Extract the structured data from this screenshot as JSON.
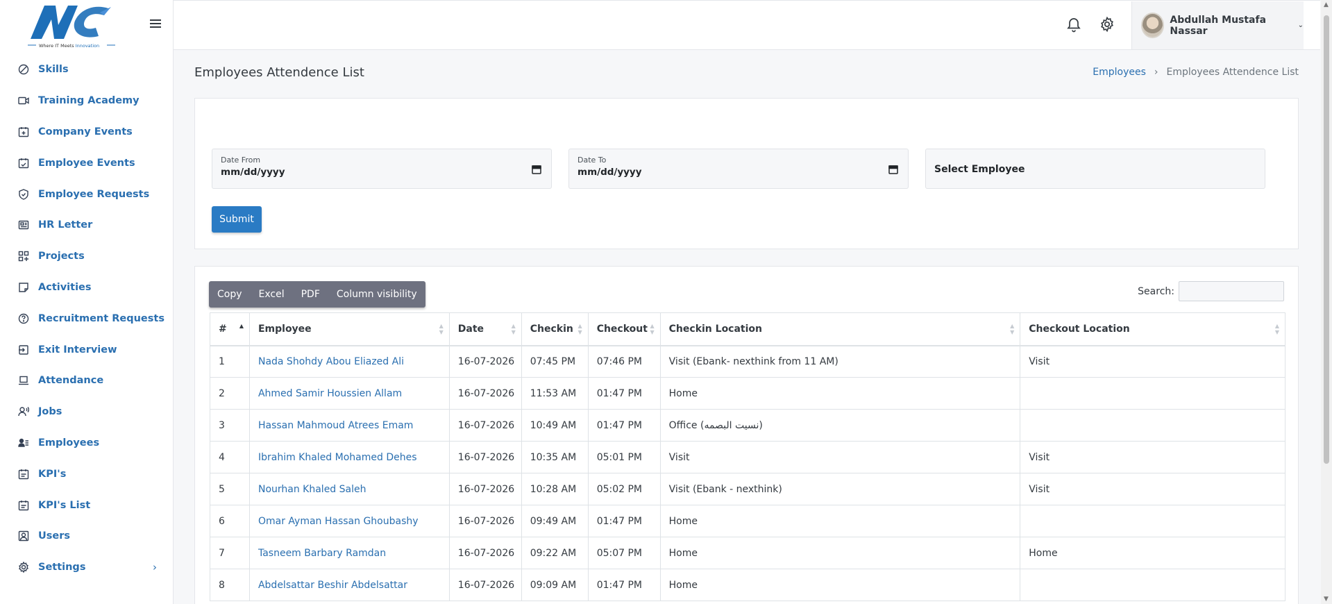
{
  "app": {
    "logo_tagline": "Where IT Meets Innovation",
    "logo_tagline_accent": "Innovation"
  },
  "sidebar": {
    "items": [
      {
        "label": "Skills",
        "icon": "skills-icon"
      },
      {
        "label": "Training Academy",
        "icon": "video-icon"
      },
      {
        "label": "Company Events",
        "icon": "calendar-plus-icon"
      },
      {
        "label": "Employee Events",
        "icon": "calendar-check-icon"
      },
      {
        "label": "Employee Requests",
        "icon": "shield-check-icon"
      },
      {
        "label": "HR Letter",
        "icon": "newspaper-icon"
      },
      {
        "label": "Projects",
        "icon": "apps-add-icon"
      },
      {
        "label": "Activities",
        "icon": "sticky-note-icon"
      },
      {
        "label": "Recruitment Requests",
        "icon": "help-circle-icon"
      },
      {
        "label": "Exit Interview",
        "icon": "exit-icon"
      },
      {
        "label": "Attendance",
        "icon": "laptop-icon"
      },
      {
        "label": "Jobs",
        "icon": "user-voice-icon"
      },
      {
        "label": "Employees",
        "icon": "user-list-icon"
      },
      {
        "label": "KPI's",
        "icon": "calendar-list-icon"
      },
      {
        "label": "KPI's List",
        "icon": "calendar-list-icon"
      },
      {
        "label": "Users",
        "icon": "user-account-icon"
      },
      {
        "label": "Settings",
        "icon": "gear-icon",
        "has_submenu": true
      }
    ],
    "chevron": "›"
  },
  "header": {
    "user_name": "Abdullah Mustafa Nassar",
    "caret": "⌄"
  },
  "page": {
    "title": "Employees Attendence List",
    "breadcrumb": {
      "parent": "Employees",
      "separator": "›",
      "current": "Employees Attendence List"
    }
  },
  "filters": {
    "date_from_label": "Date From",
    "date_from_value": "mm/dd/yyyy",
    "date_to_label": "Date To",
    "date_to_value": "mm/dd/yyyy",
    "employee_select": "Select Employee",
    "submit_label": "Submit"
  },
  "table": {
    "buttons": [
      "Copy",
      "Excel",
      "PDF",
      "Column visibility"
    ],
    "search_label": "Search:",
    "columns": [
      "#",
      "Employee",
      "Date",
      "Checkin",
      "Checkout",
      "Checkin Location",
      "Checkout Location"
    ],
    "rows": [
      [
        "1",
        "Nada Shohdy Abou Eliazed Ali",
        "16-07-2026",
        "07:45 PM",
        "07:46 PM",
        "Visit (Ebank- nexthink from 11 AM)",
        "Visit"
      ],
      [
        "2",
        "Ahmed Samir Houssien Allam",
        "16-07-2026",
        "11:53 AM",
        "01:47 PM",
        "Home",
        ""
      ],
      [
        "3",
        "Hassan Mahmoud Atrees Emam",
        "16-07-2026",
        "10:49 AM",
        "01:47 PM",
        "Office (نسيت البصمه)",
        ""
      ],
      [
        "4",
        "Ibrahim Khaled Mohamed Dehes",
        "16-07-2026",
        "10:35 AM",
        "05:01 PM",
        "Visit",
        "Visit"
      ],
      [
        "5",
        "Nourhan Khaled Saleh",
        "16-07-2026",
        "10:28 AM",
        "05:02 PM",
        "Visit (Ebank - nexthink)",
        "Visit"
      ],
      [
        "6",
        "Omar Ayman Hassan Ghoubashy",
        "16-07-2026",
        "09:49 AM",
        "01:47 PM",
        "Home",
        ""
      ],
      [
        "7",
        "Tasneem Barbary Ramdan",
        "16-07-2026",
        "09:22 AM",
        "05:07 PM",
        "Home",
        "Home"
      ],
      [
        "8",
        "Abdelsattar Beshir Abdelsattar",
        "16-07-2026",
        "09:09 AM",
        "01:47 PM",
        "Home",
        ""
      ]
    ]
  },
  "colors": {
    "accent": "#2a7bc4",
    "link": "#2a6fb0",
    "button_group": "#6e7180",
    "logo_blue": "#1e6fb8"
  }
}
